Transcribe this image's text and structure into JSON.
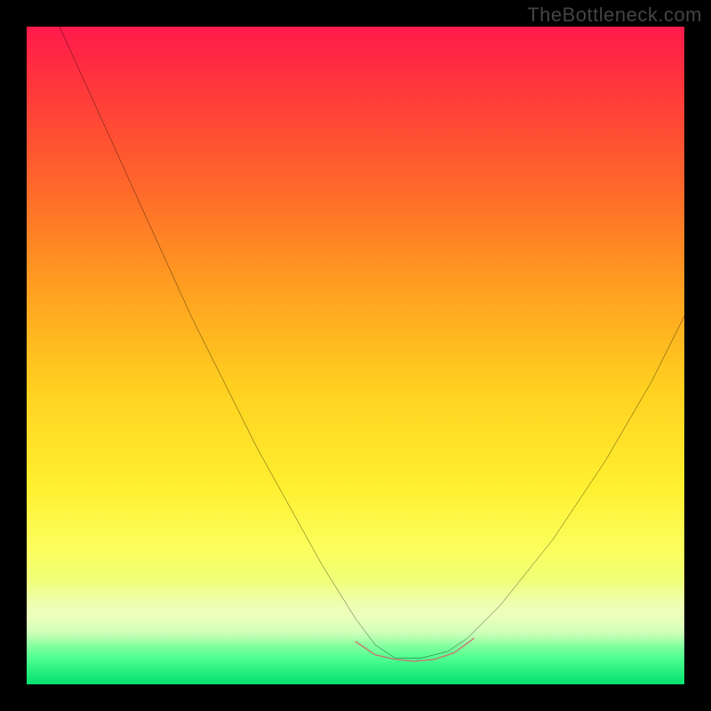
{
  "watermark": {
    "text": "TheBottleneck.com"
  },
  "chart_data": {
    "type": "line",
    "title": "",
    "xlabel": "",
    "ylabel": "",
    "xlim": [
      0,
      100
    ],
    "ylim": [
      0,
      100
    ],
    "grid": false,
    "legend": false,
    "gradient_colors": {
      "top": "#ff1a4b",
      "mid": "#ffd020",
      "bottom": "#00e070"
    },
    "notes": "V-shaped bottleneck curve on a vertical heat gradient. No axis ticks or labels are shown. X/Y values below are percentage-of-plot-area coordinates (0,0 = bottom-left; 100,100 = top-right), estimated from the image.",
    "series": [
      {
        "name": "bottleneck-curve",
        "stroke": "#000000",
        "stroke_width": 2.5,
        "x": [
          5,
          15,
          25,
          35,
          45,
          50,
          53,
          56,
          60,
          64,
          67,
          72,
          80,
          88,
          95,
          100
        ],
        "y": [
          100,
          78,
          56,
          36,
          18,
          10,
          6,
          4,
          4,
          5,
          7,
          12,
          22,
          34,
          46,
          56
        ]
      },
      {
        "name": "valley-highlight",
        "stroke": "#cc6f6f",
        "stroke_width": 9,
        "x": [
          50,
          53,
          56,
          59,
          62,
          65,
          68
        ],
        "y": [
          6.5,
          4.5,
          3.8,
          3.5,
          3.8,
          4.8,
          7
        ]
      }
    ]
  }
}
